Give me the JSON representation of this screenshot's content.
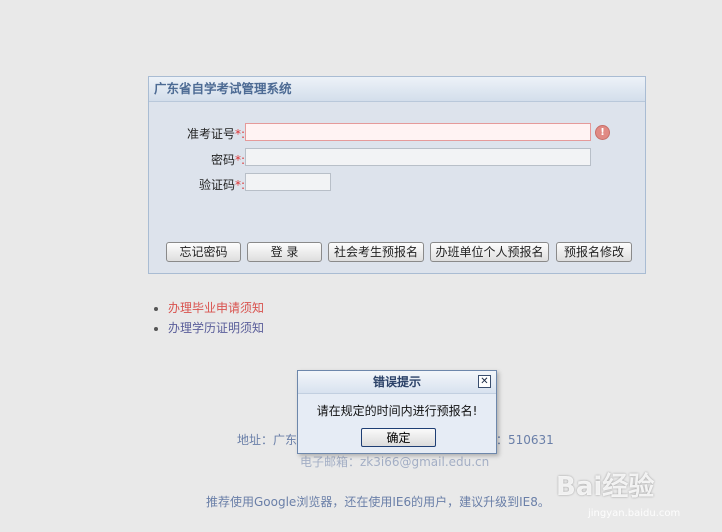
{
  "panel": {
    "title": "广东省自学考试管理系统"
  },
  "form": {
    "ticket_label": "准考证号",
    "password_label": "密码",
    "captcha_label": "验证码",
    "required_mark": "*:",
    "ticket_value": "",
    "password_value": "",
    "captcha_value": ""
  },
  "buttons": {
    "forgot": "忘记密码",
    "login": "登  录",
    "social_prereg": "社会考生预报名",
    "class_prereg": "办班单位个人预报名",
    "prereg_modify": "预报名修改"
  },
  "links": {
    "graduation": "办理毕业申请须知",
    "certificate": "办理学历证明须知"
  },
  "footer": {
    "address_prefix": "地址：广东",
    "postcode": "：510631",
    "email_partial": "电子邮箱：zk3i66@gmail.edu.cn",
    "browser_tip": "推荐使用Google浏览器，还在使用IE6的用户，建议升级到IE8。"
  },
  "dialog": {
    "title": "错误提示",
    "message": "请在规定的时间内进行预报名!",
    "ok_label": "确定",
    "close_glyph": "✕"
  },
  "watermark": {
    "text": "Bai经验",
    "sub": "jingyan.baidu.com"
  },
  "colors": {
    "link_red": "#d9534f",
    "link_blue": "#5a5e9a",
    "required": "#d33"
  }
}
